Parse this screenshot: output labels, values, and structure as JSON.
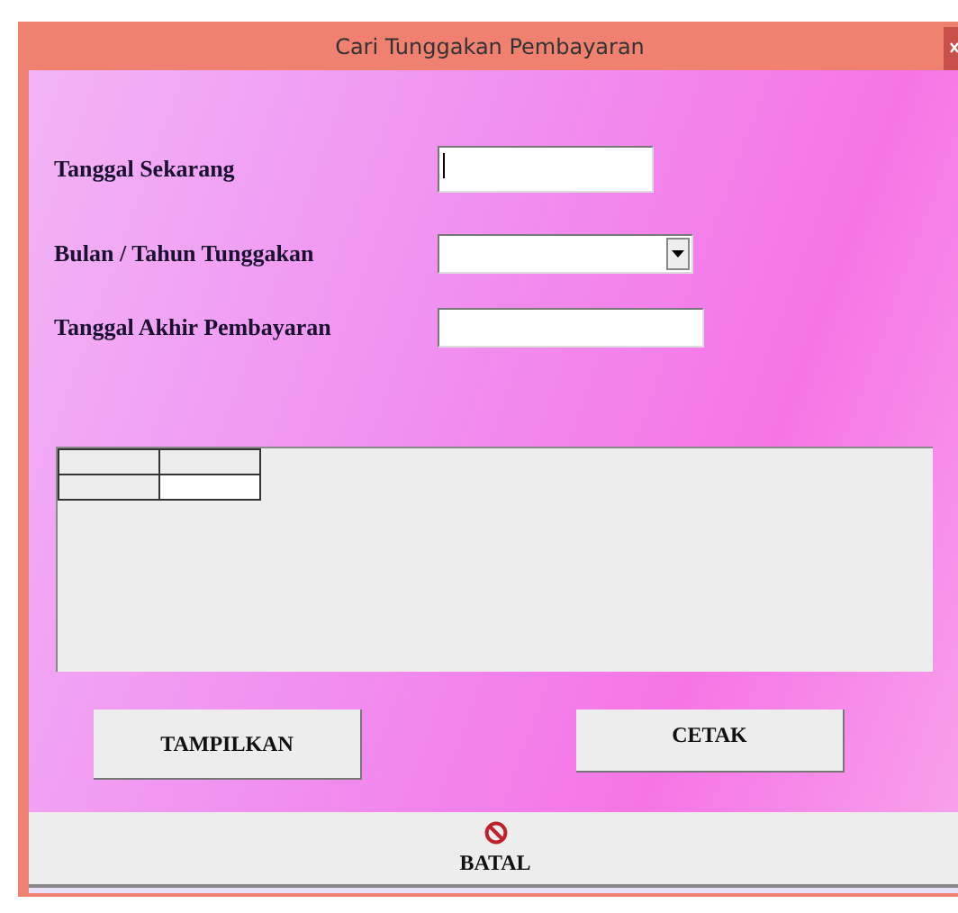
{
  "window": {
    "title": "Cari Tunggakan Pembayaran"
  },
  "fields": [
    {
      "label": "Tanggal Sekarang",
      "kind": "text",
      "focused": true
    },
    {
      "label": "Bulan / Tahun Tunggakan",
      "kind": "combo",
      "focused": false
    },
    {
      "label": "Tanggal Akhir Pembayaran",
      "kind": "text",
      "focused": false
    }
  ],
  "buttons": [
    {
      "label": "TAMPILKAN"
    },
    {
      "label": "CETAK"
    }
  ],
  "cancel_button": {
    "label": "BATAL"
  }
}
